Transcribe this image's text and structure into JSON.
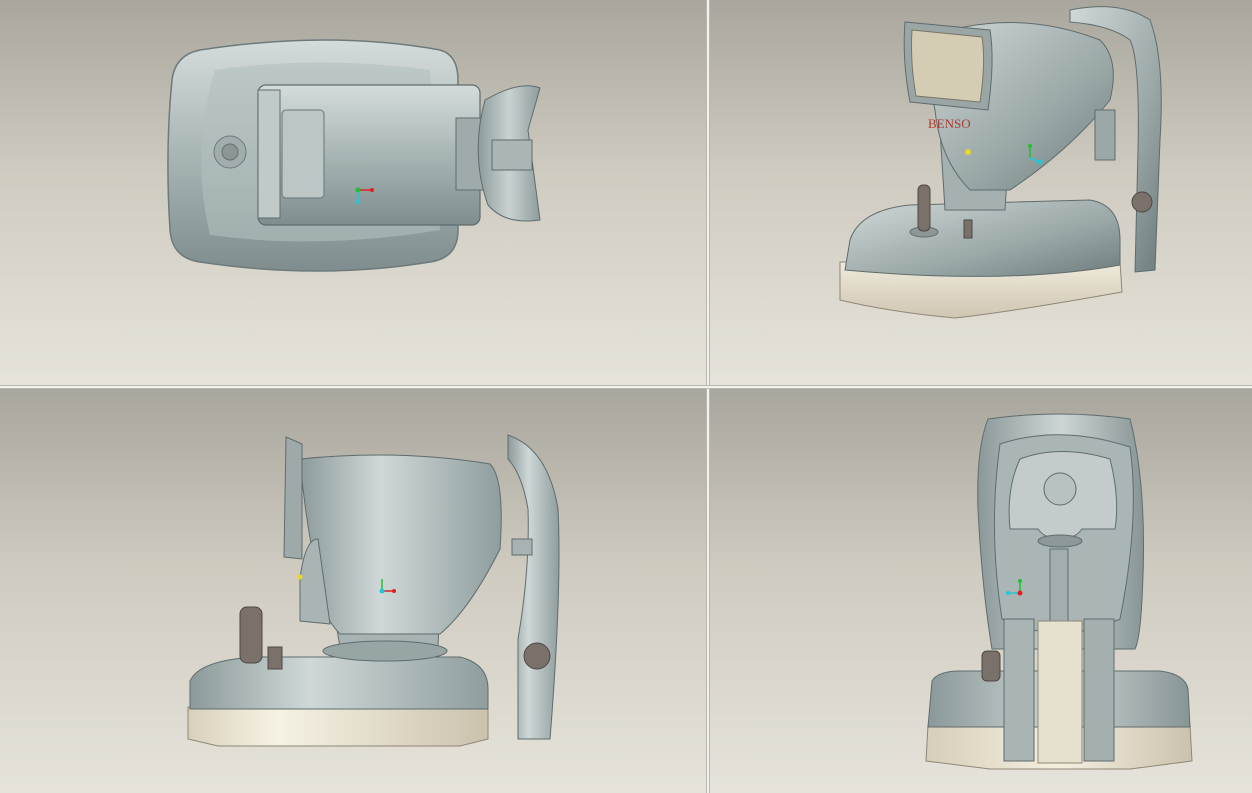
{
  "app": {
    "type": "cad-4-view-layout"
  },
  "toolbar": {
    "buttons": [
      "tool-1",
      "tool-2",
      "tool-3",
      "tool-4",
      "tool-5",
      "tool-6",
      "tool-7",
      "tool-8",
      "tool-9",
      "tool-10",
      "tool-11",
      "tool-12",
      "tool-13",
      "tool-14"
    ]
  },
  "views": {
    "top": {
      "name": "top-view"
    },
    "iso": {
      "name": "isometric-view",
      "brand_label": "BENSO"
    },
    "side": {
      "name": "side-view"
    },
    "front": {
      "name": "front-view"
    }
  },
  "colors": {
    "body": "#9aa8a8",
    "body_light": "#c6d0cf",
    "body_dark": "#6f7d7e",
    "base_beige": "#e2dccb",
    "knob_brown": "#7a716a",
    "axis_x": "#e02020",
    "axis_y": "#20c030",
    "axis_z": "#20c8d8"
  }
}
